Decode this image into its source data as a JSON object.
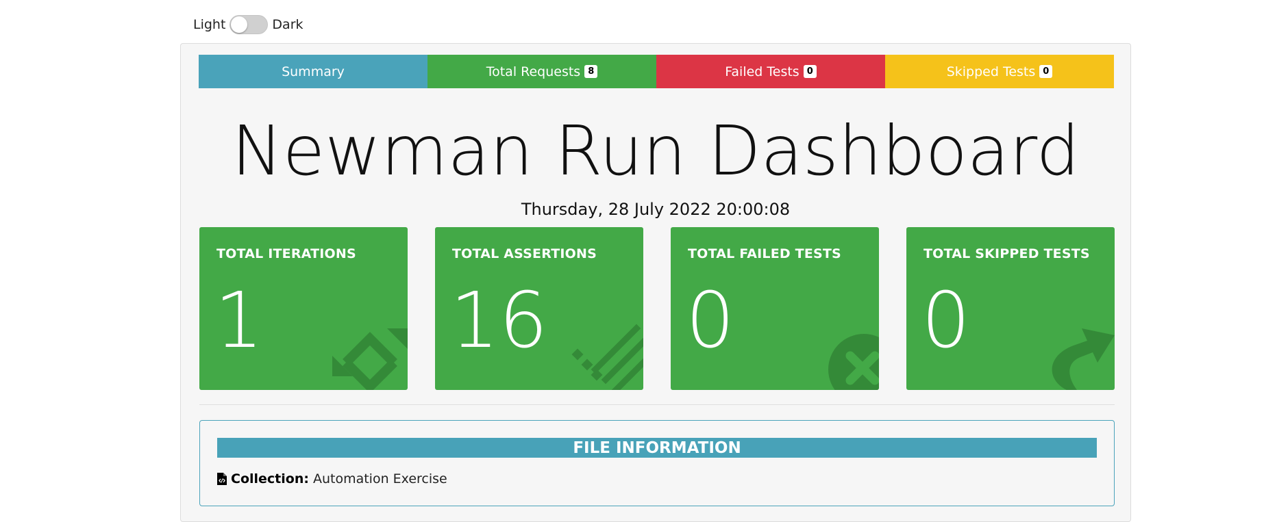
{
  "theme_toggle": {
    "light_label": "Light",
    "dark_label": "Dark",
    "checked": false
  },
  "tabs": [
    {
      "label": "Summary",
      "badge": "",
      "color": "#4aa3ba"
    },
    {
      "label": "Total Requests",
      "badge": "8",
      "color": "#43a947"
    },
    {
      "label": "Failed Tests",
      "badge": "0",
      "color": "#dc3545"
    },
    {
      "label": "Skipped Tests",
      "badge": "0",
      "color": "#f5c21a"
    }
  ],
  "hero": {
    "title": "Newman Run Dashboard",
    "date": "Thursday, 28 July 2022 20:00:08"
  },
  "cards": [
    {
      "title": "TOTAL ITERATIONS",
      "value": "1",
      "icon": "repeat-icon"
    },
    {
      "title": "TOTAL ASSERTIONS",
      "value": "16",
      "icon": "list-check-icon"
    },
    {
      "title": "TOTAL FAILED TESTS",
      "value": "0",
      "icon": "times-circle-icon"
    },
    {
      "title": "TOTAL SKIPPED TESTS",
      "value": "0",
      "icon": "share-arrow-icon"
    }
  ],
  "colors": {
    "card_green": "#43a947",
    "icon_dark_green": "#348a38",
    "info_blue": "#48a2b8"
  },
  "file_info": {
    "header": "FILE INFORMATION",
    "collection_label": "Collection:",
    "collection_value": "Automation Exercise",
    "icon": "file-code-icon"
  }
}
